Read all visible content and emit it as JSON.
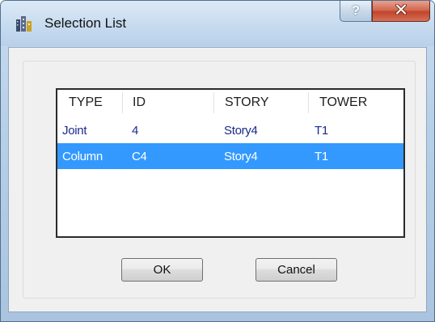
{
  "window": {
    "title": "Selection List",
    "help_glyph": "?",
    "close_glyph": "x"
  },
  "list": {
    "columns": [
      "TYPE",
      "ID",
      "STORY",
      "TOWER"
    ],
    "rows": [
      {
        "type": "Joint",
        "id": "4",
        "story": "Story4",
        "tower": "T1",
        "selected": false
      },
      {
        "type": "Column",
        "id": "C4",
        "story": "Story4",
        "tower": "T1",
        "selected": true
      }
    ],
    "selection_color": "#3399ff",
    "text_color": "#1a2a8c"
  },
  "buttons": {
    "ok_label": "OK",
    "cancel_label": "Cancel"
  },
  "icons": {
    "app": "building-icon",
    "help": "help-icon",
    "close": "close-icon"
  }
}
